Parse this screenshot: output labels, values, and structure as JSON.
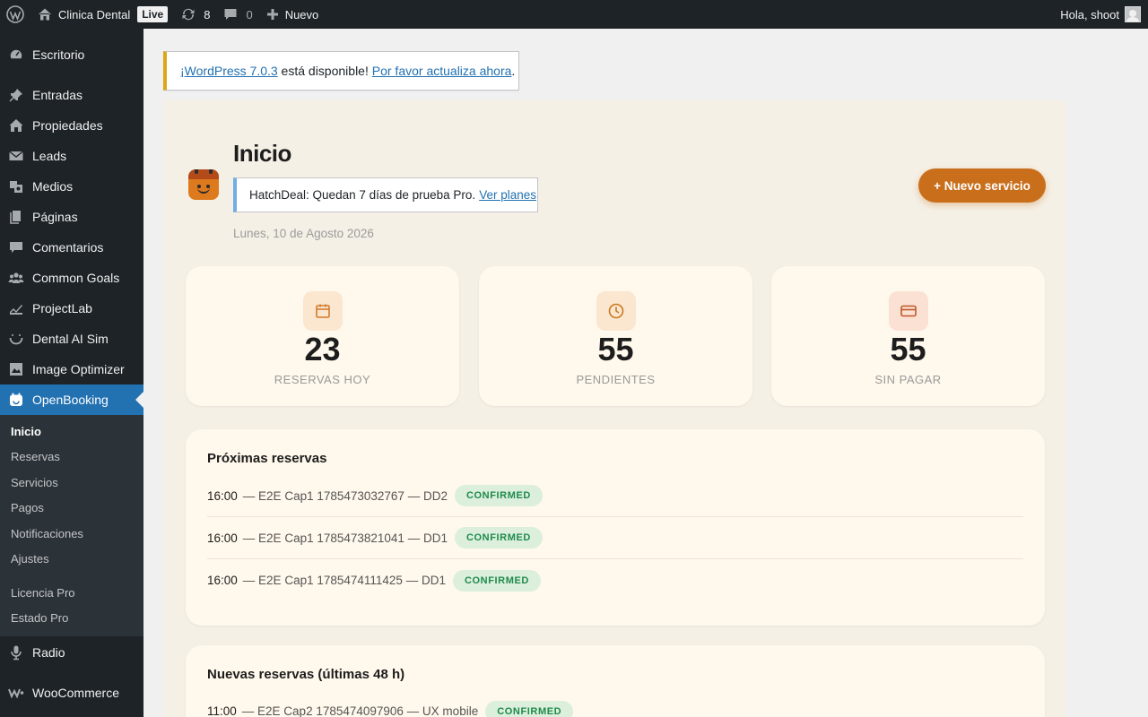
{
  "adminbar": {
    "site_name": "Clinica Dental",
    "live_badge": "Live",
    "updates_count": "8",
    "comments_count": "0",
    "new_label": "Nuevo",
    "greeting": "Hola, shoot"
  },
  "sidebar": {
    "items": [
      {
        "label": "Escritorio",
        "icon": "dashboard-icon"
      },
      {
        "label": "Entradas",
        "icon": "pin-icon"
      },
      {
        "label": "Propiedades",
        "icon": "home-icon"
      },
      {
        "label": "Leads",
        "icon": "email-icon"
      },
      {
        "label": "Medios",
        "icon": "media-icon"
      },
      {
        "label": "Páginas",
        "icon": "pages-icon"
      },
      {
        "label": "Comentarios",
        "icon": "comment-icon"
      },
      {
        "label": "Common Goals",
        "icon": "groups-icon"
      },
      {
        "label": "ProjectLab",
        "icon": "chart-icon"
      },
      {
        "label": "Dental AI Sim",
        "icon": "smile-icon"
      },
      {
        "label": "Image Optimizer",
        "icon": "image-icon"
      },
      {
        "label": "OpenBooking",
        "icon": "calendar-icon"
      }
    ],
    "submenu": [
      "Inicio",
      "Reservas",
      "Servicios",
      "Pagos",
      "Notificaciones",
      "Ajustes",
      "Licencia Pro",
      "Estado Pro"
    ],
    "after": [
      {
        "label": "Radio",
        "icon": "microphone-icon"
      },
      {
        "label": "WooCommerce",
        "icon": "woocommerce-icon"
      }
    ]
  },
  "notice": {
    "link1": "¡WordPress 7.0.3",
    "middle": " está disponible! ",
    "link2": "Por favor actualiza ahora",
    "end": "."
  },
  "app": {
    "title": "Inicio",
    "trial_brand": "HatchDeal:",
    "trial_text": " Quedan 7 días de prueba Pro.",
    "trial_link": "Ver planes",
    "date": "Lunes, 10 de Agosto 2026",
    "new_service_button": "+ Nuevo servicio",
    "stats": [
      {
        "value": "23",
        "label": "RESERVAS HOY",
        "icon": "calendar-icon",
        "color": "#d17a2a",
        "bg": "#fbe6cf"
      },
      {
        "value": "55",
        "label": "PENDIENTES",
        "icon": "clock-icon",
        "color": "#c9781f",
        "bg": "#fbe6cf"
      },
      {
        "value": "55",
        "label": "SIN PAGAR",
        "icon": "card-icon",
        "color": "#c0582a",
        "bg": "#fbe1d3"
      }
    ],
    "upcoming": {
      "title": "Próximas reservas",
      "rows": [
        {
          "time": "16:00",
          "desc": "— E2E Cap1 1785473032767 — DD2",
          "status": "CONFIRMED"
        },
        {
          "time": "16:00",
          "desc": "— E2E Cap1 1785473821041 — DD1",
          "status": "CONFIRMED"
        },
        {
          "time": "16:00",
          "desc": "— E2E Cap1 1785474111425 — DD1",
          "status": "CONFIRMED"
        }
      ]
    },
    "recent": {
      "title": "Nuevas reservas (últimas 48 h)",
      "rows": [
        {
          "time": "11:00",
          "desc": "— E2E Cap2 1785474097906 — UX mobile",
          "status": "CONFIRMED"
        }
      ]
    }
  }
}
